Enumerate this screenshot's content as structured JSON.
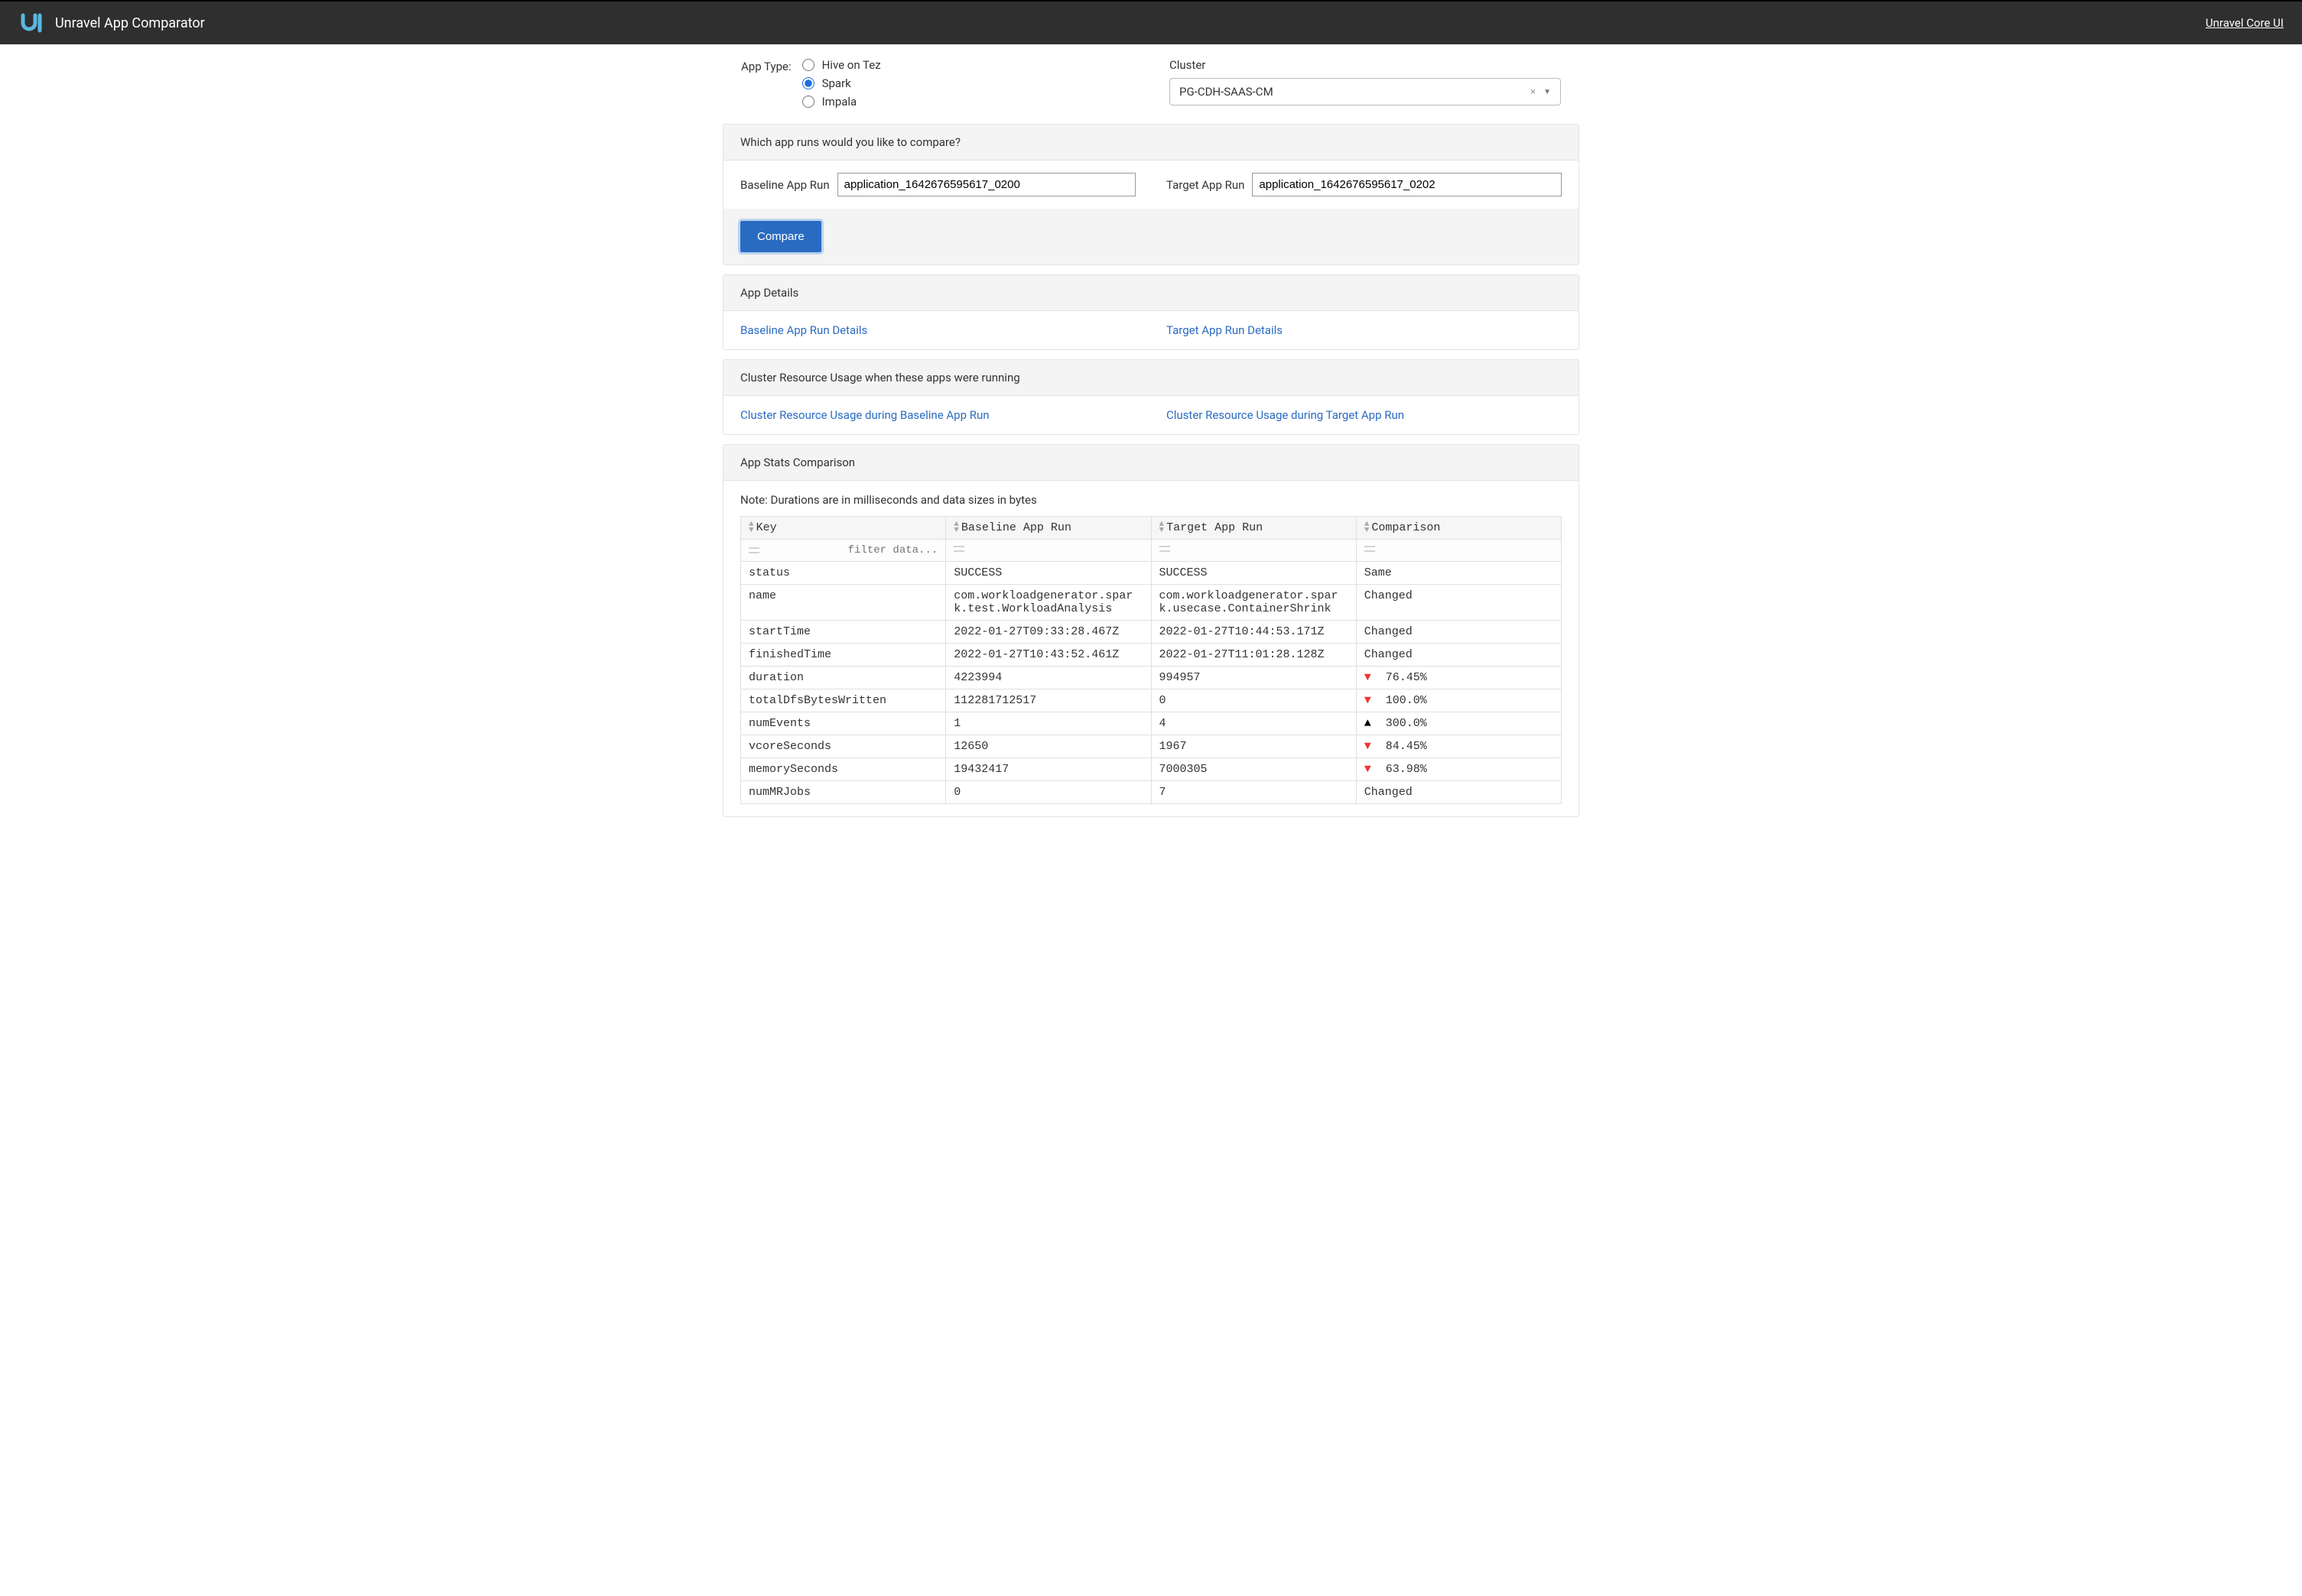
{
  "header": {
    "title": "Unravel App Comparator",
    "core_link": "Unravel Core UI"
  },
  "apptype": {
    "label": "App Type:",
    "options": [
      "Hive on Tez",
      "Spark",
      "Impala"
    ],
    "selected": "Spark"
  },
  "cluster": {
    "label": "Cluster",
    "value": "PG-CDH-SAAS-CM"
  },
  "compare_panel": {
    "heading": "Which app runs would you like to compare?",
    "baseline_label": "Baseline App Run",
    "baseline_value": "application_1642676595617_0200",
    "target_label": "Target App Run",
    "target_value": "application_1642676595617_0202",
    "button": "Compare"
  },
  "details_panel": {
    "heading": "App Details",
    "baseline_link": "Baseline App Run Details",
    "target_link": "Target App Run Details"
  },
  "cluster_usage_panel": {
    "heading": "Cluster Resource Usage when these apps were running",
    "baseline_link": "Cluster Resource Usage during Baseline App Run",
    "target_link": "Cluster Resource Usage during Target App Run"
  },
  "stats_panel": {
    "heading": "App Stats Comparison",
    "note": "Note: Durations are in milliseconds and data sizes in bytes",
    "columns": [
      "Key",
      "Baseline App Run",
      "Target App Run",
      "Comparison"
    ],
    "filter_placeholder": "filter data...",
    "rows": [
      {
        "key": "status",
        "baseline": "SUCCESS",
        "target": "SUCCESS",
        "comparison": "Same",
        "arrow": null
      },
      {
        "key": "name",
        "baseline": "com.workloadgenerator.spark.test.WorkloadAnalysis",
        "target": "com.workloadgenerator.spark.usecase.ContainerShrink",
        "comparison": "Changed",
        "arrow": null
      },
      {
        "key": "startTime",
        "baseline": "2022-01-27T09:33:28.467Z",
        "target": "2022-01-27T10:44:53.171Z",
        "comparison": "Changed",
        "arrow": null
      },
      {
        "key": "finishedTime",
        "baseline": "2022-01-27T10:43:52.461Z",
        "target": "2022-01-27T11:01:28.128Z",
        "comparison": "Changed",
        "arrow": null
      },
      {
        "key": "duration",
        "baseline": "4223994",
        "target": "994957",
        "comparison": "76.45%",
        "arrow": "down"
      },
      {
        "key": "totalDfsBytesWritten",
        "baseline": "112281712517",
        "target": "0",
        "comparison": "100.0%",
        "arrow": "down"
      },
      {
        "key": "numEvents",
        "baseline": "1",
        "target": "4",
        "comparison": "300.0%",
        "arrow": "up"
      },
      {
        "key": "vcoreSeconds",
        "baseline": "12650",
        "target": "1967",
        "comparison": "84.45%",
        "arrow": "down"
      },
      {
        "key": "memorySeconds",
        "baseline": "19432417",
        "target": "7000305",
        "comparison": "63.98%",
        "arrow": "down"
      },
      {
        "key": "numMRJobs",
        "baseline": "0",
        "target": "7",
        "comparison": "Changed",
        "arrow": null
      }
    ]
  }
}
